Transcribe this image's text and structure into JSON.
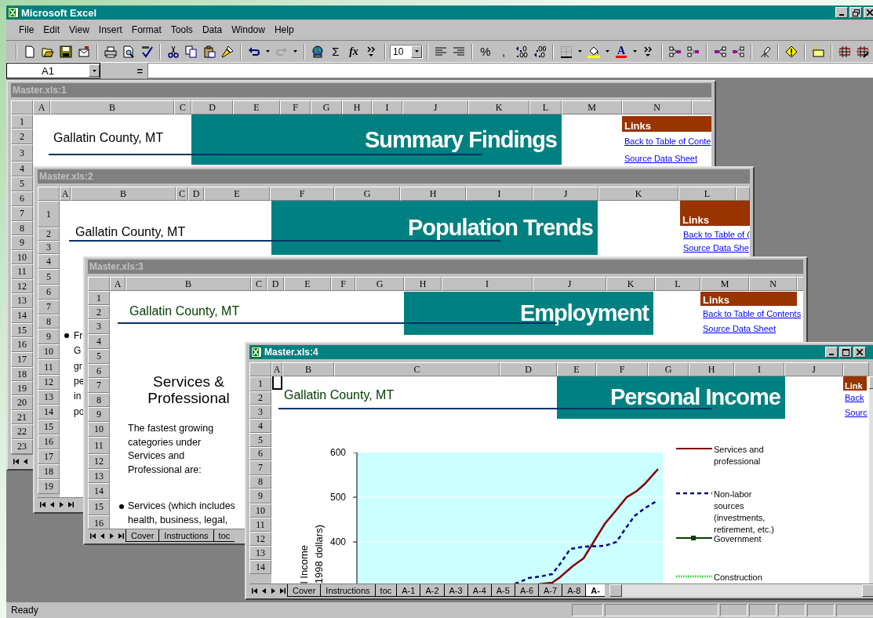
{
  "app": {
    "title": "Microsoft Excel"
  },
  "menu": [
    "File",
    "Edit",
    "View",
    "Insert",
    "Format",
    "Tools",
    "Data",
    "Window",
    "Help"
  ],
  "toolbar": {
    "autosum": "Σ",
    "function": "fx",
    "font_size": "10",
    "percent": "%",
    "comma": ",",
    "font_color": "A"
  },
  "formula_bar": {
    "name_box": "A1",
    "equals": "="
  },
  "windows": [
    {
      "title": "Master.xls:1",
      "active": false,
      "columns": [
        "A",
        "B",
        "C",
        "D",
        "E",
        "F",
        "G",
        "H",
        "I",
        "J",
        "K",
        "L",
        "M",
        "N"
      ],
      "rows": [
        "1",
        "2",
        "3",
        "4",
        "5",
        "6",
        "7",
        "8",
        "9",
        "10",
        "11",
        "12",
        "13",
        "14",
        "15",
        "16",
        "17",
        "18",
        "19",
        "20",
        "21",
        "22",
        "23"
      ],
      "county": "Gallatin County, MT",
      "banner": "Summary Findings",
      "links": {
        "header": "Links",
        "items": [
          "Back to Table of Conte",
          "Source Data Sheet"
        ]
      }
    },
    {
      "title": "Master.xls:2",
      "active": false,
      "columns": [
        "A",
        "B",
        "C",
        "D",
        "E",
        "F",
        "G",
        "H",
        "I",
        "J",
        "K",
        "L"
      ],
      "rows": [
        "1",
        "2",
        "3",
        "4",
        "5",
        "6",
        "7",
        "8",
        "9",
        "10",
        "11",
        "12",
        "13",
        "14",
        "15",
        "16",
        "17",
        "18",
        "19"
      ],
      "county": "Gallatin County, MT",
      "banner": "Population Trends",
      "links": {
        "header": "Links",
        "items": [
          "Back to Table of (",
          "Source Data She"
        ]
      },
      "fragment": [
        "Fr",
        "G",
        "gr",
        "pe",
        "in",
        "po"
      ]
    },
    {
      "title": "Master.xls:3",
      "active": false,
      "columns": [
        "A",
        "B",
        "C",
        "D",
        "E",
        "F",
        "G",
        "H",
        "I",
        "J",
        "K",
        "L",
        "M",
        "N"
      ],
      "rows": [
        "1",
        "2",
        "3",
        "4",
        "5",
        "6",
        "7",
        "8",
        "9",
        "10",
        "11",
        "12",
        "13",
        "14",
        "15",
        "16"
      ],
      "county": "Gallatin County, MT",
      "banner": "Employment",
      "links": {
        "header": "Links",
        "items": [
          "Back to Table of Contents",
          "Source Data Sheet"
        ]
      },
      "heading": "Services & Professional",
      "paragraph": "The fastest growing categories under Services and Professional are:",
      "bullets": [
        "Services (which includes health, business, legal,"
      ],
      "tabs": [
        {
          "label": "Cover",
          "selected": false
        },
        {
          "label": "Instructions",
          "selected": false
        },
        {
          "label": "toc",
          "selected": false
        }
      ]
    },
    {
      "title": "Master.xls:4",
      "active": true,
      "columns": [
        "A",
        "B",
        "C",
        "D",
        "E",
        "F",
        "G",
        "H",
        "I",
        "J"
      ],
      "rows": [
        "1",
        "2",
        "3",
        "4",
        "5",
        "6",
        "7",
        "8",
        "9",
        "10",
        "11",
        "12",
        "13",
        "14"
      ],
      "county": "Gallatin County, MT",
      "banner": "Personal Income",
      "links": {
        "header": "Link",
        "items": [
          "Back",
          "Sourc"
        ]
      },
      "chart": {
        "y_ticks": [
          "600",
          "500",
          "400"
        ],
        "y_label": [
          "l Income",
          "1998 dollars)"
        ],
        "legend": [
          {
            "label": "Services and professional",
            "kind": "solid",
            "color": "#800000"
          },
          {
            "label": "Non-labor sources (investments, retirement, etc.)",
            "kind": "dashed",
            "color": "#000080"
          },
          {
            "label": "Government",
            "kind": "marker",
            "color": "#004000"
          },
          {
            "label": "Construction",
            "kind": "dotted",
            "color": "#33cc33"
          }
        ]
      },
      "tabs": [
        {
          "label": "Cover",
          "selected": false
        },
        {
          "label": "Instructions",
          "selected": false
        },
        {
          "label": "toc",
          "selected": false
        },
        {
          "label": "A-1",
          "selected": false
        },
        {
          "label": "A-2",
          "selected": false
        },
        {
          "label": "A-3",
          "selected": false
        },
        {
          "label": "A-4",
          "selected": false
        },
        {
          "label": "A-5",
          "selected": false
        },
        {
          "label": "A-6",
          "selected": false
        },
        {
          "label": "A-7",
          "selected": false
        },
        {
          "label": "A-8",
          "selected": false
        },
        {
          "label": "A-",
          "selected": true
        }
      ]
    }
  ],
  "status_bar": {
    "text": "Ready"
  }
}
